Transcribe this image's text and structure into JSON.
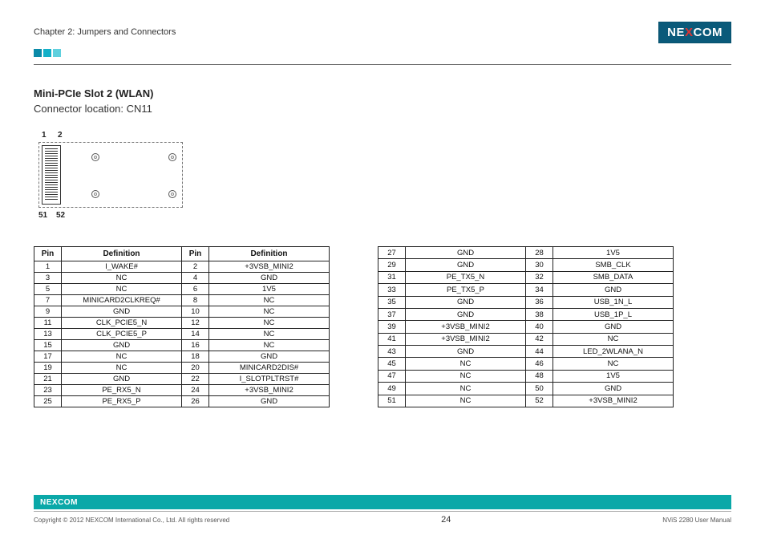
{
  "header": {
    "chapter": "Chapter 2: Jumpers and Connectors",
    "logo_text_pre": "NE",
    "logo_text_mid": "X",
    "logo_text_post": "COM"
  },
  "section": {
    "title": "Mini-PCIe Slot 2 (WLAN)",
    "subtitle": "Connector location: CN11"
  },
  "diagram": {
    "labels": {
      "top_left": "1",
      "top_right": "2",
      "bottom_left": "51",
      "bottom_right": "52"
    }
  },
  "table_headers": {
    "pin": "Pin",
    "definition": "Definition"
  },
  "table_left": [
    {
      "p1": "1",
      "d1": "I_WAKE#",
      "p2": "2",
      "d2": "+3VSB_MINI2"
    },
    {
      "p1": "3",
      "d1": "NC",
      "p2": "4",
      "d2": "GND"
    },
    {
      "p1": "5",
      "d1": "NC",
      "p2": "6",
      "d2": "1V5"
    },
    {
      "p1": "7",
      "d1": "MINICARD2CLKREQ#",
      "p2": "8",
      "d2": "NC"
    },
    {
      "p1": "9",
      "d1": "GND",
      "p2": "10",
      "d2": "NC"
    },
    {
      "p1": "11",
      "d1": "CLK_PCIE5_N",
      "p2": "12",
      "d2": "NC"
    },
    {
      "p1": "13",
      "d1": "CLK_PCIE5_P",
      "p2": "14",
      "d2": "NC"
    },
    {
      "p1": "15",
      "d1": "GND",
      "p2": "16",
      "d2": "NC"
    },
    {
      "p1": "17",
      "d1": "NC",
      "p2": "18",
      "d2": "GND"
    },
    {
      "p1": "19",
      "d1": "NC",
      "p2": "20",
      "d2": "MINICARD2DIS#"
    },
    {
      "p1": "21",
      "d1": "GND",
      "p2": "22",
      "d2": "I_SLOTPLTRST#"
    },
    {
      "p1": "23",
      "d1": "PE_RX5_N",
      "p2": "24",
      "d2": "+3VSB_MINI2"
    },
    {
      "p1": "25",
      "d1": "PE_RX5_P",
      "p2": "26",
      "d2": "GND"
    }
  ],
  "table_right": [
    {
      "p1": "27",
      "d1": "GND",
      "p2": "28",
      "d2": "1V5"
    },
    {
      "p1": "29",
      "d1": "GND",
      "p2": "30",
      "d2": "SMB_CLK"
    },
    {
      "p1": "31",
      "d1": "PE_TX5_N",
      "p2": "32",
      "d2": "SMB_DATA"
    },
    {
      "p1": "33",
      "d1": "PE_TX5_P",
      "p2": "34",
      "d2": "GND"
    },
    {
      "p1": "35",
      "d1": "GND",
      "p2": "36",
      "d2": "USB_1N_L"
    },
    {
      "p1": "37",
      "d1": "GND",
      "p2": "38",
      "d2": "USB_1P_L"
    },
    {
      "p1": "39",
      "d1": "+3VSB_MINI2",
      "p2": "40",
      "d2": "GND"
    },
    {
      "p1": "41",
      "d1": "+3VSB_MINI2",
      "p2": "42",
      "d2": "NC"
    },
    {
      "p1": "43",
      "d1": "GND",
      "p2": "44",
      "d2": "LED_2WLANA_N"
    },
    {
      "p1": "45",
      "d1": "NC",
      "p2": "46",
      "d2": "NC"
    },
    {
      "p1": "47",
      "d1": "NC",
      "p2": "48",
      "d2": "1V5"
    },
    {
      "p1": "49",
      "d1": "NC",
      "p2": "50",
      "d2": "GND"
    },
    {
      "p1": "51",
      "d1": "NC",
      "p2": "52",
      "d2": "+3VSB_MINI2"
    }
  ],
  "footer": {
    "copyright": "Copyright © 2012 NEXCOM International Co., Ltd. All rights reserved",
    "page": "24",
    "manual": "NViS 2280 User Manual"
  }
}
